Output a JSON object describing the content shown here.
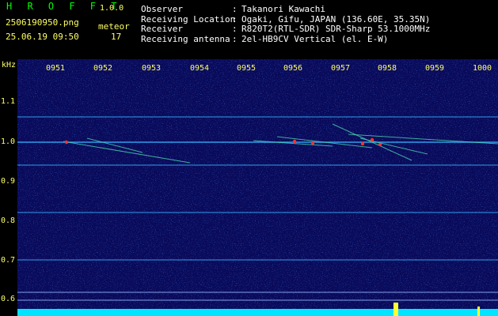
{
  "header": {
    "app_title": "H R O F F T",
    "app_version": "1.0.0",
    "filename": "2506190950.png",
    "datetime": "25.06.19 09:50",
    "meteor_label": "meteor",
    "meteor_count": "17",
    "info": [
      {
        "key": "Observer",
        "value": "Takanori Kawachi"
      },
      {
        "key": "Receiving Location",
        "value": "Ogaki, Gifu, JAPAN (136.60E, 35.35N)"
      },
      {
        "key": "Receiver",
        "value": "R820T2(RTL-SDR) SDR-Sharp 53.1000MHz"
      },
      {
        "key": "Receiving antenna",
        "value": "2el-HB9CV Vertical (el. E-W)"
      }
    ],
    "separator": ":"
  },
  "spectrogram": {
    "unit_label": "kHz",
    "y_ticks": [
      "1.1",
      "1.0",
      "0.9",
      "0.8",
      "0.7",
      "0.6"
    ],
    "x_ticks": [
      "0951",
      "0952",
      "0953",
      "0954",
      "0955",
      "0956",
      "0957",
      "0958",
      "0959",
      "1000"
    ],
    "colors": {
      "background": "#0a0a5a",
      "axis_text": "#ffff66",
      "carrier_line": "#37b6ff",
      "echo": "#ff3030",
      "noise_floor": "#00e5ff"
    }
  }
}
